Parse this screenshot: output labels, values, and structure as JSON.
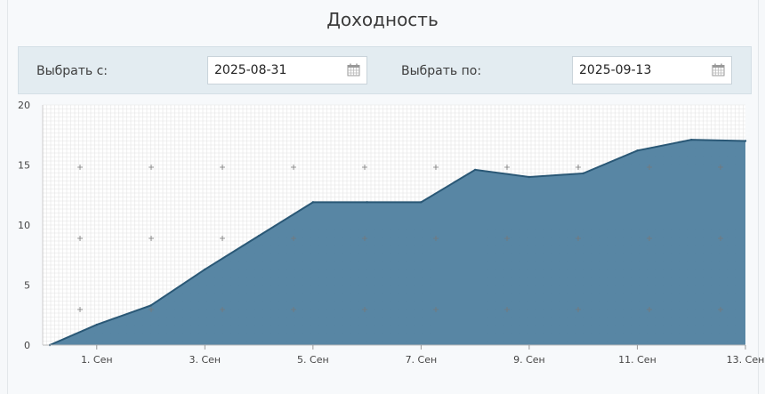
{
  "header": {
    "title": "Доходность"
  },
  "filters": {
    "from_label": "Выбрать с:",
    "from_value": "2025-08-31",
    "to_label": "Выбрать по:",
    "to_value": "2025-09-13",
    "calendar_icon": "calendar-icon"
  },
  "colors": {
    "area_fill": "#4f7f9f",
    "area_stroke": "#2a5876",
    "grid": "#e4e4e4",
    "panel_bg": "#f7f9fb"
  },
  "chart_data": {
    "type": "area",
    "x": [
      "2025-08-31",
      "2025-09-01",
      "2025-09-02",
      "2025-09-03",
      "2025-09-04",
      "2025-09-05",
      "2025-09-06",
      "2025-09-07",
      "2025-09-08",
      "2025-09-09",
      "2025-09-10",
      "2025-09-11",
      "2025-09-12",
      "2025-09-13"
    ],
    "series": [
      {
        "values": [
          0,
          1.7,
          3.3,
          6.3,
          9.1,
          11.9,
          11.9,
          11.9,
          14.6,
          14.0,
          14.3,
          16.2,
          17.1,
          17.0
        ]
      }
    ],
    "xticks": [
      "1. Сен",
      "3. Сен",
      "5. Сен",
      "7. Сен",
      "9. Сен",
      "11. Сен",
      "13. Сен"
    ],
    "xtick_dates": [
      "2025-09-01",
      "2025-09-03",
      "2025-09-05",
      "2025-09-07",
      "2025-09-09",
      "2025-09-11",
      "2025-09-13"
    ],
    "yticks": [
      0,
      5,
      10,
      15,
      20
    ],
    "ylim": [
      0,
      20
    ],
    "xlim": [
      "2025-08-31",
      "2025-09-13"
    ],
    "grid": true
  }
}
